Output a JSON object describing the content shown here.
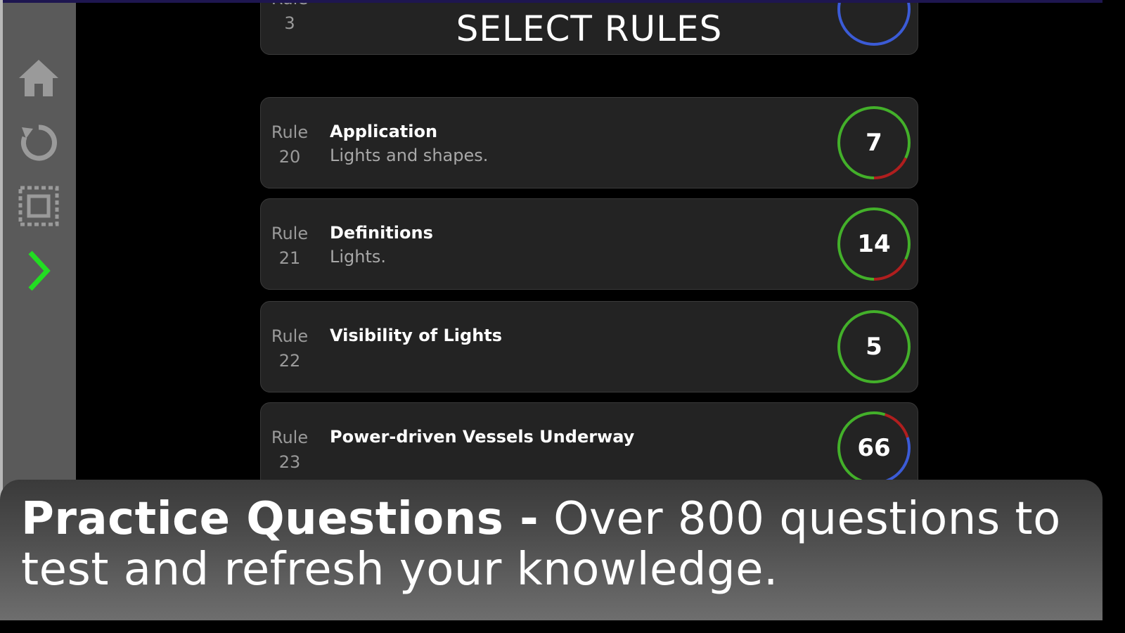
{
  "header": {
    "title": "SELECT RULES"
  },
  "sidebar": {
    "items": [
      {
        "name": "home-icon",
        "color": "#9a9a9a"
      },
      {
        "name": "reset-icon",
        "color": "#9a9a9a"
      },
      {
        "name": "select-all-icon",
        "color": "#9a9a9a"
      },
      {
        "name": "next-chevron-icon",
        "color": "#22dd22"
      }
    ]
  },
  "rules": [
    {
      "label": "Rule",
      "number": "3",
      "name": "",
      "description": "",
      "count": "",
      "ring_colors": [
        "#3b5bd6"
      ]
    },
    {
      "label": "Rule",
      "number": "20",
      "name": "Application",
      "description": "Lights and shapes.",
      "count": "7",
      "ring_colors": [
        "#43b02a",
        "#b01e1e"
      ]
    },
    {
      "label": "Rule",
      "number": "21",
      "name": "Definitions",
      "description": "Lights.",
      "count": "14",
      "ring_colors": [
        "#43b02a",
        "#b01e1e"
      ]
    },
    {
      "label": "Rule",
      "number": "22",
      "name": "Visibility of Lights",
      "description": "",
      "count": "5",
      "ring_colors": [
        "#43b02a"
      ]
    },
    {
      "label": "Rule",
      "number": "23",
      "name": "Power-driven Vessels Underway",
      "description": "",
      "count": "66",
      "ring_colors": [
        "#43b02a",
        "#b01e1e",
        "#3b5bd6"
      ]
    }
  ],
  "caption": {
    "bold": "Practice Questions -",
    "rest": " Over 800 questions to test and refresh your knowledge."
  }
}
